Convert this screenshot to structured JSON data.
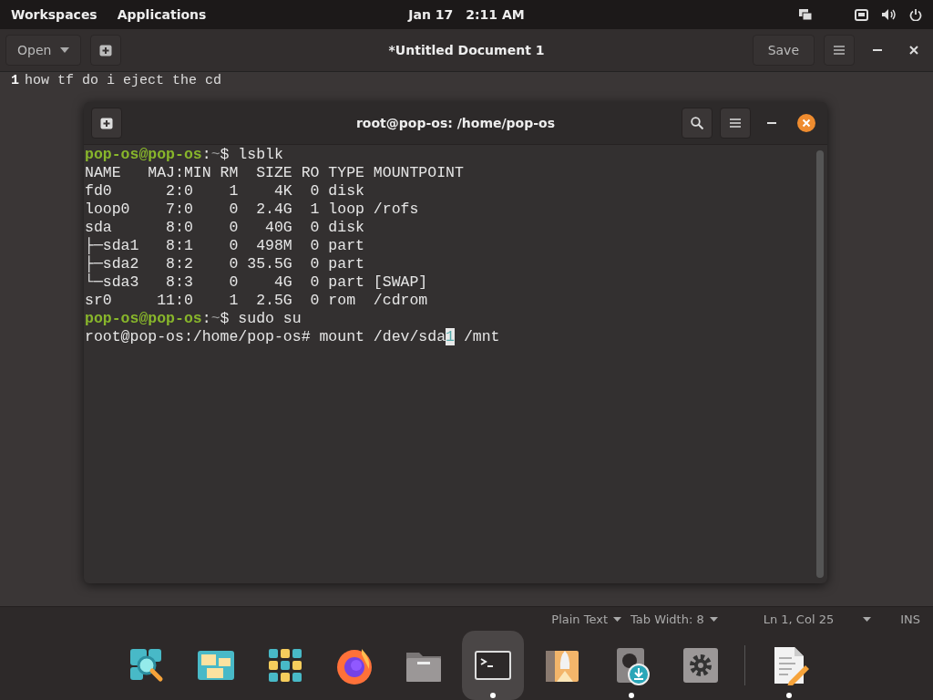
{
  "top_bar": {
    "workspaces": "Workspaces",
    "applications": "Applications",
    "date": "Jan 17",
    "time": "2:11 AM"
  },
  "editor_window": {
    "open_button": "Open",
    "title": "*Untitled Document 1",
    "save_button": "Save",
    "lines": [
      {
        "number": "1",
        "text": "how tf do i eject the cd"
      }
    ],
    "status_bar": {
      "language": "Plain Text",
      "tab_width": "Tab Width: 8",
      "position": "Ln 1, Col 25",
      "mode": "INS"
    }
  },
  "terminal_window": {
    "title": "root@pop-os: /home/pop-os",
    "lines": [
      {
        "kind": "prompt",
        "user": "pop-os@pop-os",
        "sep": ":",
        "path": "~",
        "sign": "$",
        "command": "lsblk"
      },
      {
        "kind": "output",
        "text": "NAME   MAJ:MIN RM  SIZE RO TYPE MOUNTPOINT"
      },
      {
        "kind": "output",
        "text": "fd0      2:0    1    4K  0 disk "
      },
      {
        "kind": "output",
        "text": "loop0    7:0    0  2.4G  1 loop /rofs"
      },
      {
        "kind": "output",
        "text": "sda      8:0    0   40G  0 disk "
      },
      {
        "kind": "output",
        "text": "├─sda1   8:1    0  498M  0 part "
      },
      {
        "kind": "output",
        "text": "├─sda2   8:2    0 35.5G  0 part "
      },
      {
        "kind": "output",
        "text": "└─sda3   8:3    0    4G  0 part [SWAP]"
      },
      {
        "kind": "output",
        "text": "sr0     11:0    1  2.5G  0 rom  /cdrom"
      },
      {
        "kind": "prompt",
        "user": "pop-os@pop-os",
        "sep": ":",
        "path": "~",
        "sign": "$",
        "command": "sudo su"
      },
      {
        "kind": "root",
        "text": "root@pop-os:/home/pop-os# mount /dev/sda",
        "cursor": "1",
        "after": " /mnt"
      }
    ]
  },
  "dock": {
    "items": [
      {
        "kind": "search",
        "running": false,
        "selected": false
      },
      {
        "kind": "windows",
        "running": false,
        "selected": false
      },
      {
        "kind": "apps",
        "running": false,
        "selected": false
      },
      {
        "kind": "firefox",
        "running": false,
        "selected": false
      },
      {
        "kind": "files",
        "running": false,
        "selected": false
      },
      {
        "kind": "terminal",
        "running": true,
        "selected": true
      },
      {
        "kind": "store",
        "running": false,
        "selected": false
      },
      {
        "kind": "installer",
        "running": true,
        "selected": false
      },
      {
        "kind": "settings",
        "running": false,
        "selected": false
      },
      {
        "kind": "separator"
      },
      {
        "kind": "editor",
        "running": true,
        "selected": false
      }
    ]
  }
}
